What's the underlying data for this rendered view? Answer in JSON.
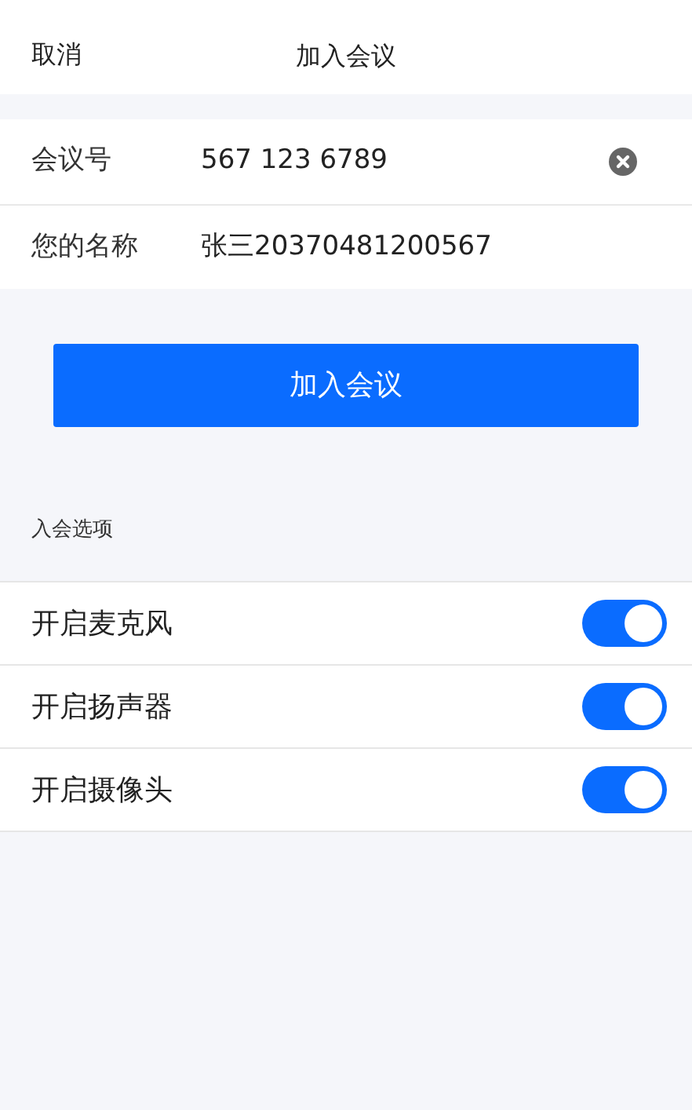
{
  "header": {
    "cancel": "取消",
    "title": "加入会议"
  },
  "fields": [
    {
      "label": "会议号",
      "value": "567 123 6789",
      "clearable": true
    },
    {
      "label": "您的名称",
      "value": "张三20370481200567",
      "clearable": false
    }
  ],
  "join_button": "加入会议",
  "options": {
    "title": "入会选项",
    "items": [
      {
        "label": "开启麦克风",
        "on": true
      },
      {
        "label": "开启扬声器",
        "on": true
      },
      {
        "label": "开启摄像头",
        "on": true
      }
    ]
  }
}
